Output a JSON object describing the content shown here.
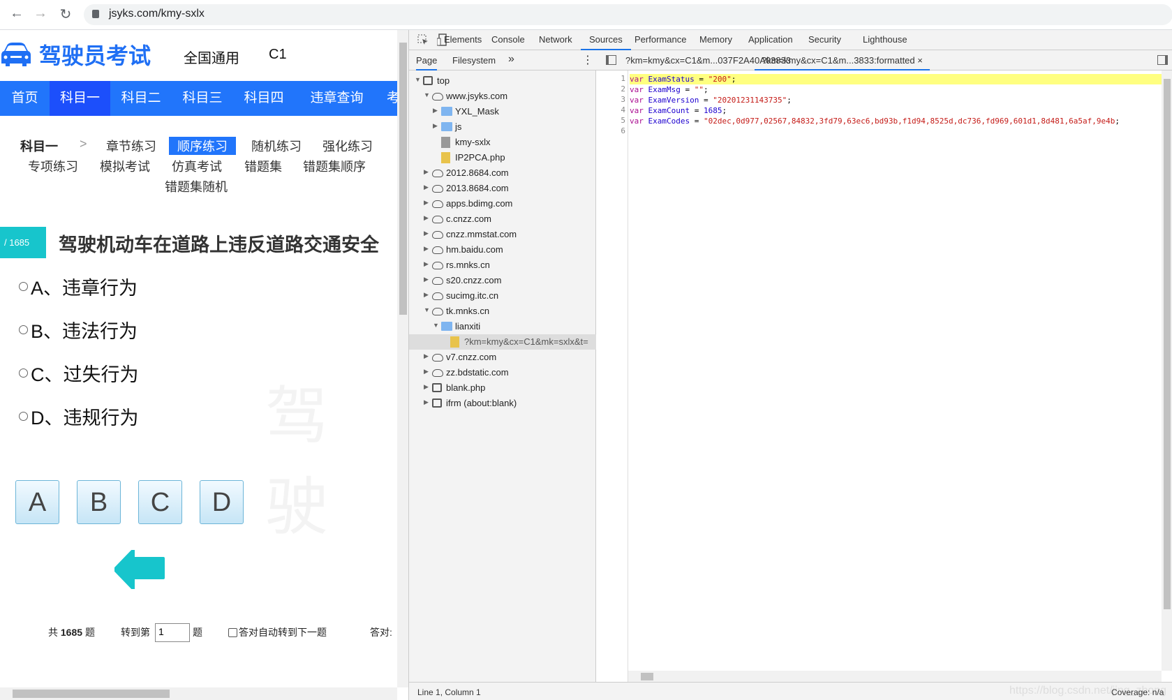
{
  "browser": {
    "url": "jsyks.com/kmy-sxlx",
    "back": "←",
    "forward": "→",
    "reload": "↻"
  },
  "site": {
    "logo_text": "驾驶员考试",
    "region": "全国通用",
    "license": "C1",
    "nav": [
      "首页",
      "科目一",
      "科目二",
      "科目三",
      "科目四",
      "违章查询",
      "考试"
    ],
    "nav_active": "科目一",
    "sub_title": "科目一",
    "sub_sep": ">",
    "sub_items": [
      "章节练习",
      "顺序练习",
      "随机练习",
      "强化练习",
      "专项练习",
      "模拟考试",
      "仿真考试",
      "错题集",
      "错题集顺序",
      "错题集随机"
    ],
    "sub_active": "顺序练习",
    "question_badge": "/ 1685",
    "question_title": "驾驶机动车在道路上违反道路交通安全",
    "options": [
      "A、违章行为",
      "B、违法行为",
      "C、过失行为",
      "D、违规行为"
    ],
    "answer_buttons": [
      "A",
      "B",
      "C",
      "D"
    ],
    "footer": {
      "total_prefix": "共",
      "total": "1685",
      "total_suffix": "题",
      "goto_prefix": "转到第",
      "goto_value": "1",
      "goto_suffix": "题",
      "auto_next": "答对自动转到下一题",
      "correct_label": "答对:"
    },
    "watermark": "驾驶",
    "accent": "#2175fb",
    "teal": "#17c5cc"
  },
  "devtools": {
    "tabs": [
      "Elements",
      "Console",
      "Network",
      "Sources",
      "Performance",
      "Memory",
      "Application",
      "Security",
      "Lighthouse"
    ],
    "active_tab": "Sources",
    "navigator_tabs": [
      "Page",
      "Filesystem"
    ],
    "more": "»",
    "file_tabs": [
      "?km=kmy&cx=C1&m...037F2A40A03833",
      "?km=kmy&cx=C1&m...3833:formatted"
    ],
    "close": "×",
    "tree": [
      {
        "label": "top",
        "icon": "frame",
        "depth": 0,
        "arrow": "▼"
      },
      {
        "label": "www.jsyks.com",
        "icon": "cloud",
        "depth": 1,
        "arrow": "▼"
      },
      {
        "label": "YXL_Mask",
        "icon": "folder",
        "depth": 2,
        "arrow": "▶"
      },
      {
        "label": "js",
        "icon": "folder",
        "depth": 2,
        "arrow": "▶"
      },
      {
        "label": "kmy-sxlx",
        "icon": "gfile",
        "depth": 2,
        "arrow": ""
      },
      {
        "label": "IP2PCA.php",
        "icon": "file",
        "depth": 2,
        "arrow": ""
      },
      {
        "label": "2012.8684.com",
        "icon": "cloud",
        "depth": 1,
        "arrow": "▶"
      },
      {
        "label": "2013.8684.com",
        "icon": "cloud",
        "depth": 1,
        "arrow": "▶"
      },
      {
        "label": "apps.bdimg.com",
        "icon": "cloud",
        "depth": 1,
        "arrow": "▶"
      },
      {
        "label": "c.cnzz.com",
        "icon": "cloud",
        "depth": 1,
        "arrow": "▶"
      },
      {
        "label": "cnzz.mmstat.com",
        "icon": "cloud",
        "depth": 1,
        "arrow": "▶"
      },
      {
        "label": "hm.baidu.com",
        "icon": "cloud",
        "depth": 1,
        "arrow": "▶"
      },
      {
        "label": "rs.mnks.cn",
        "icon": "cloud",
        "depth": 1,
        "arrow": "▶"
      },
      {
        "label": "s20.cnzz.com",
        "icon": "cloud",
        "depth": 1,
        "arrow": "▶"
      },
      {
        "label": "sucimg.itc.cn",
        "icon": "cloud",
        "depth": 1,
        "arrow": "▶"
      },
      {
        "label": "tk.mnks.cn",
        "icon": "cloud",
        "depth": 1,
        "arrow": "▼"
      },
      {
        "label": "lianxiti",
        "icon": "folder",
        "depth": 2,
        "arrow": "▼"
      },
      {
        "label": "?km=kmy&cx=C1&mk=sxlx&t=",
        "icon": "file",
        "depth": 3,
        "arrow": "",
        "selected": true
      },
      {
        "label": "v7.cnzz.com",
        "icon": "cloud",
        "depth": 1,
        "arrow": "▶"
      },
      {
        "label": "zz.bdstatic.com",
        "icon": "cloud",
        "depth": 1,
        "arrow": "▶"
      },
      {
        "label": "blank.php",
        "icon": "frame",
        "depth": 1,
        "arrow": "▶"
      },
      {
        "label": "ifrm (about:blank)",
        "icon": "frame",
        "depth": 1,
        "arrow": "▶"
      }
    ],
    "code": [
      {
        "n": "1",
        "name": "ExamStatus",
        "val": "\"200\"",
        "type": "st"
      },
      {
        "n": "2",
        "name": "ExamMsg",
        "val": "\"\"",
        "type": "st"
      },
      {
        "n": "3",
        "name": "ExamVersion",
        "val": "\"20201231143735\"",
        "type": "st"
      },
      {
        "n": "4",
        "name": "ExamCount",
        "val": "1685",
        "type": "nm"
      },
      {
        "n": "5",
        "name": "ExamCodes",
        "val": "\"02dec,0d977,02567,84832,3fd79,63ec6,bd93b,f1d94,8525d,dc736,fd969,601d1,8d481,6a5af,9e4b",
        "type": "st"
      },
      {
        "n": "6",
        "name": "",
        "val": "",
        "type": ""
      }
    ],
    "keyword": "var",
    "status_left": "Line 1, Column 1",
    "status_right": "Coverage: n/a",
    "status_watermark": "https://blog.csdn.net/jing_zhong"
  }
}
